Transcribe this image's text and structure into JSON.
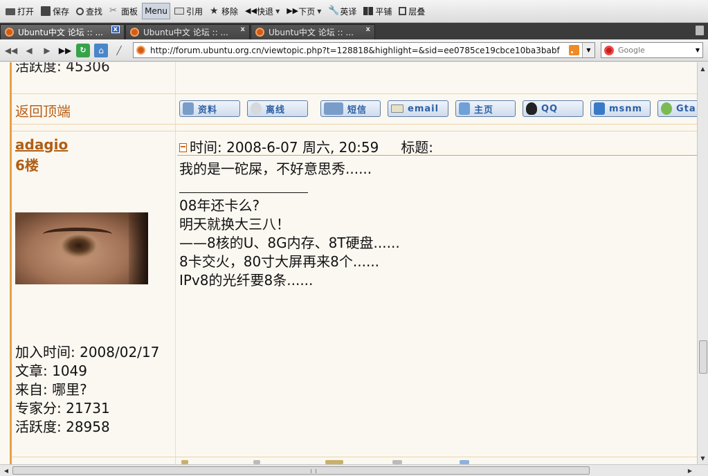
{
  "toolbar": {
    "items": [
      {
        "label": "打开",
        "icon": "folder-open-icon"
      },
      {
        "label": "保存",
        "icon": "floppy-disk-icon"
      },
      {
        "label": "查找",
        "icon": "magnifier-icon"
      },
      {
        "label": "面板",
        "icon": "scissors-icon"
      },
      {
        "label": "Menu",
        "icon": ""
      },
      {
        "label": "引用",
        "icon": "quote-icon"
      },
      {
        "label": "移除",
        "icon": "star-icon"
      },
      {
        "label": "快退",
        "icon": "fast-back-icon"
      },
      {
        "label": "下页",
        "icon": "fast-forward-icon"
      },
      {
        "label": "英译",
        "icon": "wrench-icon"
      },
      {
        "label": "平铺",
        "icon": "tile-icon"
      },
      {
        "label": "层叠",
        "icon": "cascade-icon"
      }
    ]
  },
  "tabs": [
    {
      "title": "Ubuntu中文 论坛 :: ...",
      "close": "x"
    },
    {
      "title": "Ubuntu中文 论坛 :: ...",
      "close": "x"
    },
    {
      "title": "Ubuntu中文 论坛 :: ...",
      "close": "x"
    }
  ],
  "address": {
    "url": "http://forum.ubuntu.org.cn/viewtopic.php?t=128818&highlight=&sid=ee0785ce19cbce10ba3babf",
    "search_placeholder": "Google"
  },
  "previous_post": {
    "activity_partial": "活跃度: 45306",
    "back_to_top": "返回顶端",
    "buttons": [
      {
        "label": "资料",
        "icon": "profile-icon"
      },
      {
        "label": "离线",
        "icon": "offline-bulb-icon"
      },
      {
        "label": "短信",
        "icon": "pm-icon"
      },
      {
        "label": "email",
        "icon": "email-icon"
      },
      {
        "label": "主页",
        "icon": "homepage-icon"
      },
      {
        "label": "QQ",
        "icon": "qq-penguin-icon"
      },
      {
        "label": "msnm",
        "icon": "msn-icon"
      },
      {
        "label": "Gta",
        "icon": "gtalk-icon"
      }
    ]
  },
  "post": {
    "author": "adagio",
    "floor": "6楼",
    "join_date": "加入时间: 2008/02/17",
    "posts": "文章: 1049",
    "from": "来自: 哪里?",
    "expert_score": "专家分: 21731",
    "activity": "活跃度: 28958",
    "time": "时间: 2008-6-07 周六, 20:59",
    "subject_label": "标题:",
    "body": "我的是一砣屎，不好意思秀......",
    "signature": [
      "08年还卡么?",
      "明天就换大三八！",
      "——8核的U、8G内存、8T硬盘......",
      "8卡交火，80寸大屏再来8个......",
      "IPv8的光纤要8条......"
    ]
  }
}
